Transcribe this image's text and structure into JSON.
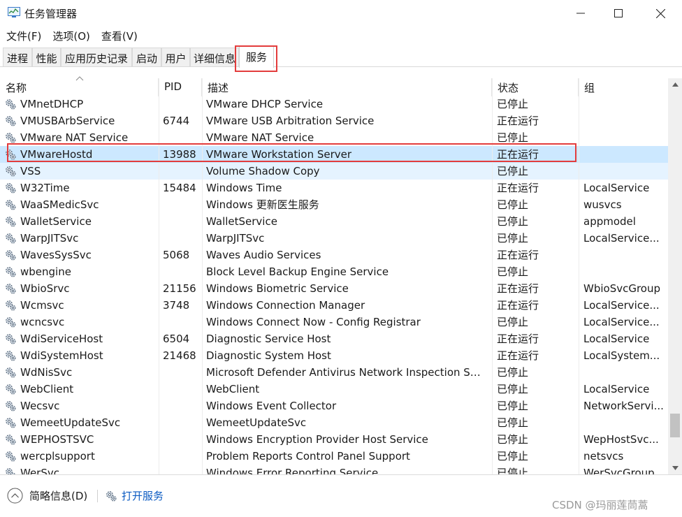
{
  "window": {
    "title": "任务管理器",
    "controls": [
      "minimize-icon",
      "maximize-icon",
      "close-icon"
    ]
  },
  "menu": [
    "文件(F)",
    "选项(O)",
    "查看(V)"
  ],
  "tabs": [
    {
      "label": "进程",
      "active": false
    },
    {
      "label": "性能",
      "active": false
    },
    {
      "label": "应用历史记录",
      "active": false
    },
    {
      "label": "启动",
      "active": false
    },
    {
      "label": "用户",
      "active": false
    },
    {
      "label": "详细信息",
      "active": false
    },
    {
      "label": "服务",
      "active": true
    }
  ],
  "columns": {
    "name": "名称",
    "pid": "PID",
    "desc": "描述",
    "status": "状态",
    "group": "组"
  },
  "rows": [
    {
      "name": "VMnetDHCP",
      "pid": "",
      "desc": "VMware DHCP Service",
      "status": "已停止",
      "group": ""
    },
    {
      "name": "VMUSBArbService",
      "pid": "6744",
      "desc": "VMware USB Arbitration Service",
      "status": "正在运行",
      "group": ""
    },
    {
      "name": "VMware NAT Service",
      "pid": "",
      "desc": "VMware NAT Service",
      "status": "已停止",
      "group": ""
    },
    {
      "name": "VMwareHostd",
      "pid": "13988",
      "desc": "VMware Workstation Server",
      "status": "正在运行",
      "group": ""
    },
    {
      "name": "VSS",
      "pid": "",
      "desc": "Volume Shadow Copy",
      "status": "已停止",
      "group": ""
    },
    {
      "name": "W32Time",
      "pid": "15484",
      "desc": "Windows Time",
      "status": "正在运行",
      "group": "LocalService"
    },
    {
      "name": "WaaSMedicSvc",
      "pid": "",
      "desc": "Windows 更新医生服务",
      "status": "已停止",
      "group": "wusvcs"
    },
    {
      "name": "WalletService",
      "pid": "",
      "desc": "WalletService",
      "status": "已停止",
      "group": "appmodel"
    },
    {
      "name": "WarpJITSvc",
      "pid": "",
      "desc": "WarpJITSvc",
      "status": "已停止",
      "group": "LocalService..."
    },
    {
      "name": "WavesSysSvc",
      "pid": "5068",
      "desc": "Waves Audio Services",
      "status": "正在运行",
      "group": ""
    },
    {
      "name": "wbengine",
      "pid": "",
      "desc": "Block Level Backup Engine Service",
      "status": "已停止",
      "group": ""
    },
    {
      "name": "WbioSrvc",
      "pid": "21156",
      "desc": "Windows Biometric Service",
      "status": "正在运行",
      "group": "WbioSvcGroup"
    },
    {
      "name": "Wcmsvc",
      "pid": "3748",
      "desc": "Windows Connection Manager",
      "status": "正在运行",
      "group": "LocalService..."
    },
    {
      "name": "wcncsvc",
      "pid": "",
      "desc": "Windows Connect Now - Config Registrar",
      "status": "已停止",
      "group": "LocalService..."
    },
    {
      "name": "WdiServiceHost",
      "pid": "6504",
      "desc": "Diagnostic Service Host",
      "status": "正在运行",
      "group": "LocalService"
    },
    {
      "name": "WdiSystemHost",
      "pid": "21468",
      "desc": "Diagnostic System Host",
      "status": "正在运行",
      "group": "LocalSystem..."
    },
    {
      "name": "WdNisSvc",
      "pid": "",
      "desc": "Microsoft Defender Antivirus Network Inspection Ser...",
      "status": "已停止",
      "group": ""
    },
    {
      "name": "WebClient",
      "pid": "",
      "desc": "WebClient",
      "status": "已停止",
      "group": "LocalService"
    },
    {
      "name": "Wecsvc",
      "pid": "",
      "desc": "Windows Event Collector",
      "status": "已停止",
      "group": "NetworkServi..."
    },
    {
      "name": "WemeetUpdateSvc",
      "pid": "",
      "desc": "WemeetUpdateSvc",
      "status": "已停止",
      "group": ""
    },
    {
      "name": "WEPHOSTSVC",
      "pid": "",
      "desc": "Windows Encryption Provider Host Service",
      "status": "已停止",
      "group": "WepHostSvc..."
    },
    {
      "name": "wercplsupport",
      "pid": "",
      "desc": "Problem Reports Control Panel Support",
      "status": "已停止",
      "group": "netsvcs"
    },
    {
      "name": "WerSvc",
      "pid": "",
      "desc": "Windows Error Reporting Service",
      "status": "已停止",
      "group": "WerSvcGroup"
    }
  ],
  "footer": {
    "fewer_details": "简略信息(D)",
    "open_services": "打开服务",
    "watermark": "CSDN @玛丽莲茼蒿"
  },
  "scroll_position": 0.93,
  "colors": {
    "selected_row": "#cce8ff",
    "hover_row": "#e5f3ff",
    "annotation": "#e33c3c",
    "link": "#0a5ac2"
  }
}
